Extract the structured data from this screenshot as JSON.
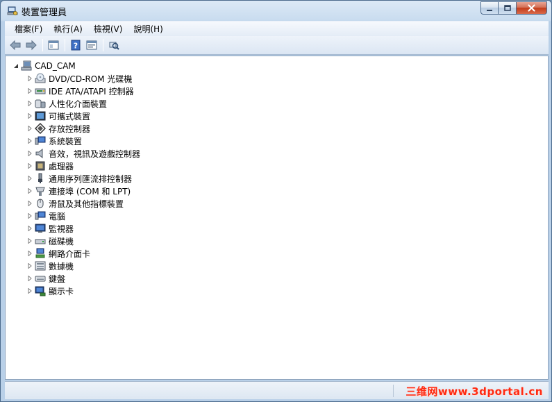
{
  "window": {
    "title": "裝置管理員"
  },
  "menu": [
    "檔案(F)",
    "執行(A)",
    "檢視(V)",
    "說明(H)"
  ],
  "toolbar": {
    "icons": [
      "back-arrow-icon",
      "forward-arrow-icon",
      "show-hide-tree-icon",
      "help-icon",
      "properties-icon",
      "scan-hardware-icon"
    ]
  },
  "tree": {
    "root": "CAD_CAM",
    "items": [
      "DVD/CD-ROM 光碟機",
      "IDE ATA/ATAPI 控制器",
      "人性化介面裝置",
      "可攜式裝置",
      "存放控制器",
      "系統裝置",
      "音效，視訊及遊戲控制器",
      "處理器",
      "通用序列匯流排控制器",
      "連接埠 (COM 和 LPT)",
      "滑鼠及其他指標裝置",
      "電腦",
      "監視器",
      "磁碟機",
      "網路介面卡",
      "數據機",
      "鍵盤",
      "顯示卡"
    ]
  },
  "statusbar": {
    "watermark": "三维网www.3dportal.cn"
  },
  "colors": {
    "close_button": "#c43c1a",
    "watermark": "#ff2a12",
    "selection": "#3399ff"
  }
}
